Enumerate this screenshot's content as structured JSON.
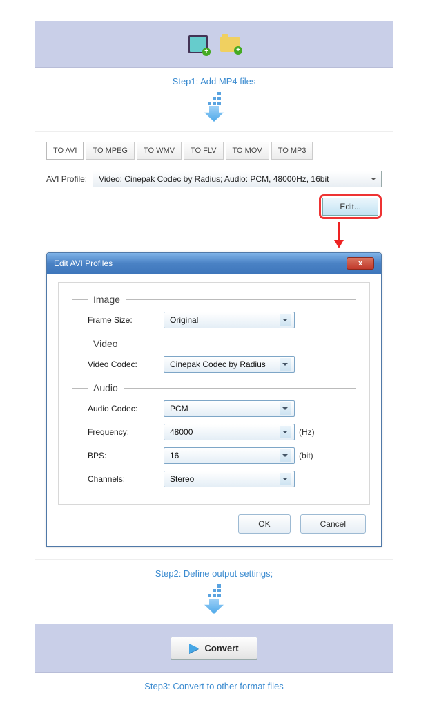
{
  "icons": {
    "add_file_plus": "+",
    "add_folder_plus": "+"
  },
  "step1_label": "Step1: Add MP4 files",
  "tabs": [
    "TO AVI",
    "TO MPEG",
    "TO WMV",
    "TO FLV",
    "TO MOV",
    "TO MP3"
  ],
  "profile_label": "AVI Profile:",
  "profile_value": "Video: Cinepak Codec by Radius; Audio: PCM, 48000Hz, 16bit",
  "edit_label": "Edit...",
  "dialog": {
    "title": "Edit AVI Profiles",
    "close_label": "x",
    "groups": {
      "image": "Image",
      "video": "Video",
      "audio": "Audio"
    },
    "fields": {
      "frame_size": {
        "label": "Frame Size:",
        "value": "Original"
      },
      "video_codec": {
        "label": "Video Codec:",
        "value": "Cinepak Codec by Radius"
      },
      "audio_codec": {
        "label": "Audio Codec:",
        "value": "PCM"
      },
      "frequency": {
        "label": "Frequency:",
        "value": "48000",
        "unit": "(Hz)"
      },
      "bps": {
        "label": "BPS:",
        "value": "16",
        "unit": "(bit)"
      },
      "channels": {
        "label": "Channels:",
        "value": "Stereo"
      }
    },
    "ok_label": "OK",
    "cancel_label": "Cancel"
  },
  "step2_label": "Step2: Define output settings;",
  "convert_label": "Convert",
  "step3_label": "Step3: Convert to other format files"
}
